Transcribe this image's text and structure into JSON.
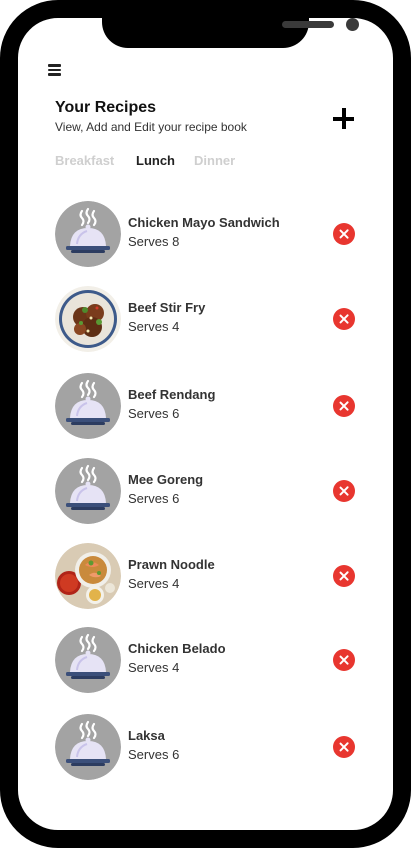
{
  "header": {
    "title": "Your Recipes",
    "subtitle": "View, Add and Edit your recipe book"
  },
  "icons": {
    "menu": "hamburger-menu-icon",
    "add": "plus-icon",
    "delete": "close-circle-icon",
    "placeholder": "food-cloche-icon"
  },
  "tabs": [
    {
      "label": "Breakfast",
      "active": false
    },
    {
      "label": "Lunch",
      "active": true
    },
    {
      "label": "Dinner",
      "active": false
    }
  ],
  "recipes": [
    {
      "name": "Chicken Mayo Sandwich",
      "serves": "Serves 8",
      "image": "placeholder"
    },
    {
      "name": "Beef Stir Fry",
      "serves": "Serves 4",
      "image": "photo-stir-fry"
    },
    {
      "name": "Beef Rendang",
      "serves": "Serves 6",
      "image": "placeholder"
    },
    {
      "name": "Mee Goreng",
      "serves": "Serves 6",
      "image": "placeholder"
    },
    {
      "name": "Prawn Noodle",
      "serves": "Serves 4",
      "image": "photo-prawn-noodle"
    },
    {
      "name": "Chicken Belado",
      "serves": "Serves 4",
      "image": "placeholder"
    },
    {
      "name": "Laksa",
      "serves": "Serves 6",
      "image": "placeholder"
    }
  ],
  "colors": {
    "delete": "#e8362f",
    "tab_inactive": "#cfcfcf",
    "placeholder_bg": "#a3a3a3"
  }
}
